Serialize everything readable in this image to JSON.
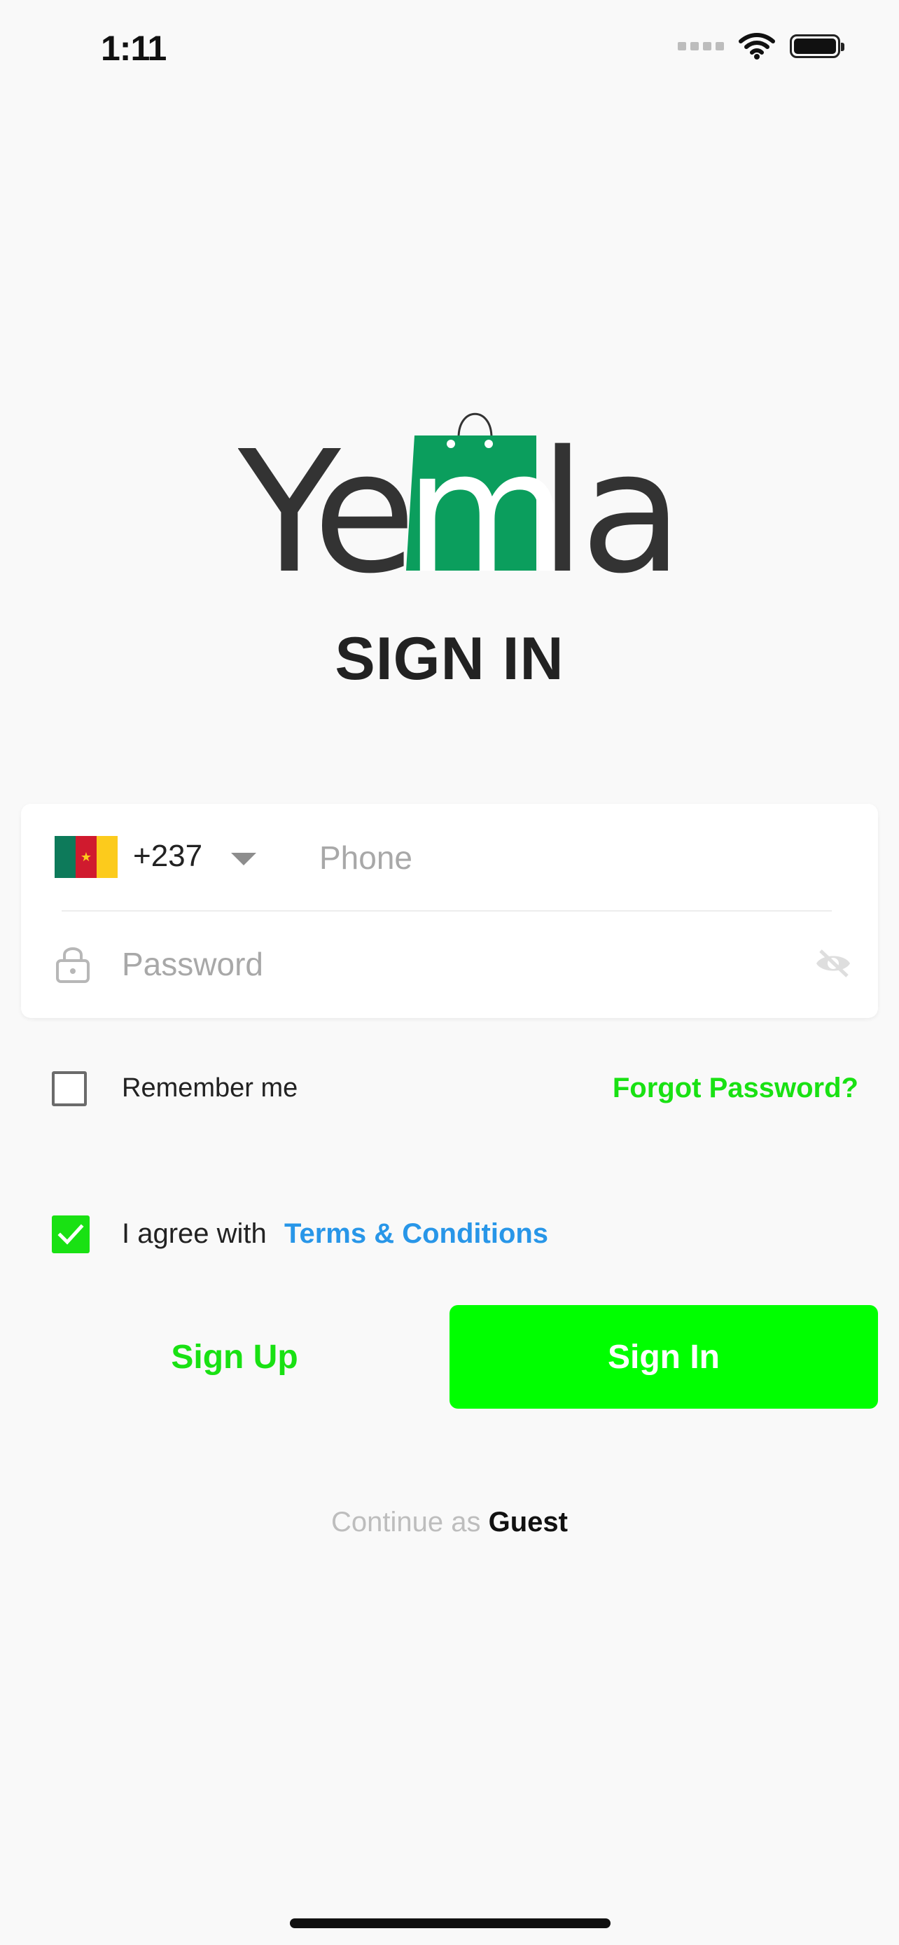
{
  "status_bar": {
    "time": "1:11",
    "icons": [
      "cellular-signal-icon",
      "wifi-icon",
      "battery-icon"
    ]
  },
  "logo": {
    "text": "Yemla",
    "brand_colors": {
      "dark": "#333333",
      "green": "#0b9e5d"
    }
  },
  "page": {
    "title": "SIGN IN"
  },
  "login_form": {
    "country": {
      "code": "+237",
      "flag_icon": "cameroon-flag-icon"
    },
    "phone": {
      "placeholder": "Phone",
      "value": ""
    },
    "password": {
      "placeholder": "Password",
      "value": "",
      "visibility_icon": "eye-off-icon"
    }
  },
  "options": {
    "remember_me": {
      "label": "Remember me",
      "checked": false
    },
    "forgot_password": "Forgot Password?",
    "terms": {
      "prefix": "I agree with",
      "link": "Terms & Conditions",
      "checked": true
    }
  },
  "actions": {
    "signup_label": "Sign Up",
    "signin_label": "Sign In",
    "guest_prefix": "Continue as",
    "guest_link": "Guest"
  },
  "colors": {
    "accent_green": "#19e113",
    "signin_button": "#00ff00",
    "link_blue": "#2896e8",
    "background": "#f9f9f9"
  }
}
